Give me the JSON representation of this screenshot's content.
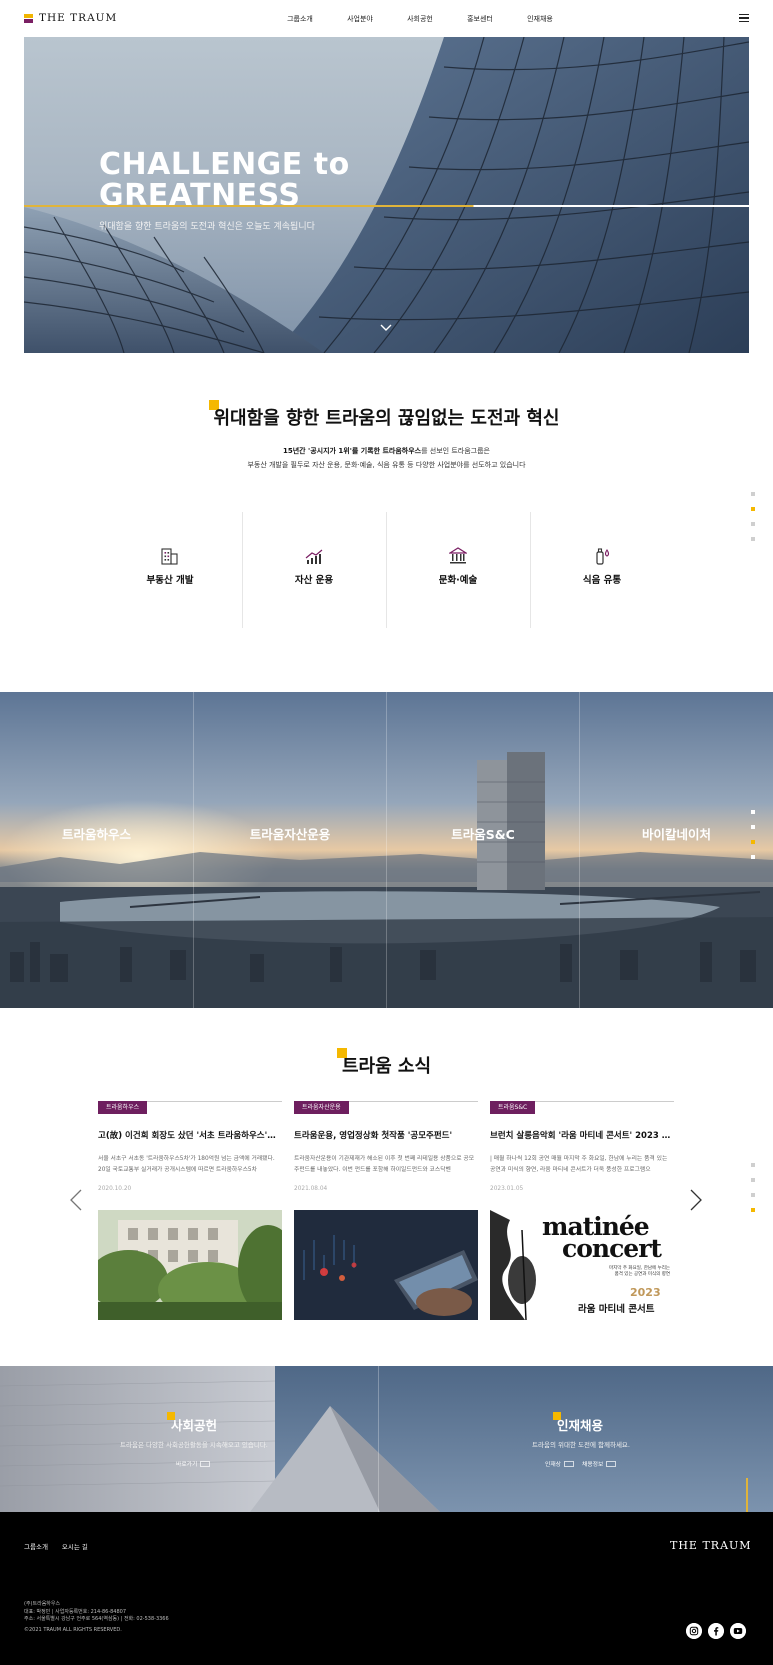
{
  "header": {
    "logo": "THE TRAUM",
    "nav": [
      "그룹소개",
      "사업분야",
      "사회공헌",
      "홍보센터",
      "인재채용"
    ]
  },
  "hero": {
    "title_line1": "CHALLENGE to",
    "title_line2": "GREATNESS",
    "subtitle": "위대함을 향한 트라움의 도전과 혁신은 오늘도 계속됩니다"
  },
  "intro": {
    "title": "위대함을 향한 트라움의 끊임없는 도전과 혁신",
    "desc_line1_bold": "15년간 '공시지가 1위'를 기록한 트라움하우스",
    "desc_line1_rest": "를 선보인 트라움그룹은",
    "desc_line2": "부동산 개발을 필두로 자산 운용, 문화·예술, 식음 유통 등 다양한 사업분야를 선도하고 있습니다",
    "business": [
      {
        "label": "부동산 개발",
        "icon": "building-icon"
      },
      {
        "label": "자산 운용",
        "icon": "chart-icon"
      },
      {
        "label": "문화·예술",
        "icon": "museum-icon"
      },
      {
        "label": "식음 유통",
        "icon": "bottle-icon"
      }
    ]
  },
  "affiliates": [
    "트라움하우스",
    "트라움자산운용",
    "트라움S&C",
    "바이칼네이처"
  ],
  "news": {
    "title": "트라움 소식",
    "cards": [
      {
        "tag": "트라움하우스",
        "title": "고(故) 이건희 회장도 샀던 '서초 트라움하우스'…",
        "body": "서울 서초구 서초동 '트라움하우스5차'가 180억원 넘는 금액에 거래됐다. 20일 국토교통부 실거래가 공개시스템에 따르면 트라움하우스5차",
        "date": "2020.10.20"
      },
      {
        "tag": "트라움자산운용",
        "title": "트라움운용, 영업정상화 첫작품 '공모주펀드'",
        "body": "트라움자산운용이 기관제재가 해소된 이후 첫 번째 리테일용 상품으로 공모주펀드를 내놓았다. 이번 펀드를 포함해 하이일드펀드와 코스닥벤",
        "date": "2021.08.04"
      },
      {
        "tag": "트라움S&C",
        "title": "브런치 살롱음악회 '라움 마티네 콘서트' 2023 …",
        "body": "| 매월 하나씩 12회 공연 매월 마지막 주 화요일, 한남에 누리는 품격 있는 공연과 미식의 향연, 라움 마티네 콘서트가 더욱 풍성한 프로그램으",
        "date": "2023.01.05",
        "poster_title1": "matinée",
        "poster_title2": "concert",
        "poster_text1": "마지막 주 화요일, 한남에 누리는",
        "poster_text2": "품격 있는 공연과 미식의 향연",
        "poster_year": "2023",
        "poster_name": "라움 마티네 콘서트"
      }
    ]
  },
  "social": {
    "title": "사회공헌",
    "desc": "트라움은 다양한 사회공헌활동을 지속해오고 있습니다.",
    "link": "바로가기"
  },
  "recruit": {
    "title": "인재채용",
    "desc": "트라움의 위대한 도전에 함께하세요.",
    "link1": "인재상",
    "link2": "채용정보"
  },
  "footer": {
    "links": [
      "그룹소개",
      "오시는 길"
    ],
    "logo": "THE TRAUM",
    "company": "(주)트라움하우스",
    "info1": "대표: 박정민 | 사업자등록번호: 214-86-84807",
    "info2": "주소: 서울특별시 강남구 언주로 564(역삼동) | 전화: 02-538-3366",
    "copyright": "©2021 TRAUM ALL RIGHTS RESERVED.",
    "sns": [
      "instagram-icon",
      "facebook-icon",
      "youtube-icon"
    ]
  },
  "colors": {
    "accent_yellow": "#f5b800",
    "brand_purple": "#6e1f5f"
  }
}
